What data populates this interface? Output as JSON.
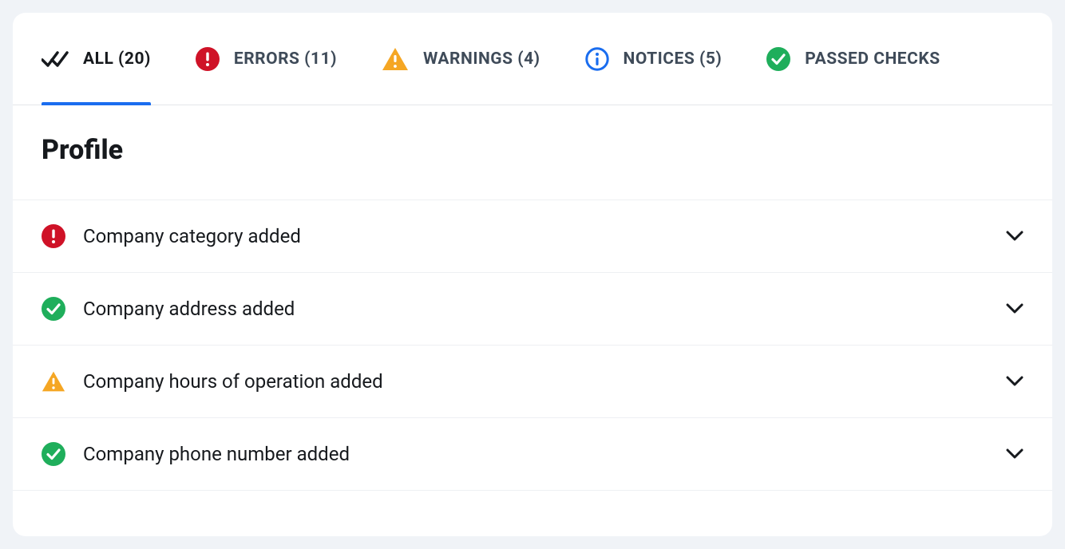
{
  "tabs": {
    "all": {
      "label": "ALL (20)"
    },
    "errors": {
      "label": "ERRORS (11)"
    },
    "warnings": {
      "label": "WARNINGS (4)"
    },
    "notices": {
      "label": "NOTICES (5)"
    },
    "passed": {
      "label": "PASSED CHECKS"
    }
  },
  "section": {
    "title": "Profile"
  },
  "items": [
    {
      "label": "Company category added",
      "status": "error"
    },
    {
      "label": "Company address added",
      "status": "passed"
    },
    {
      "label": "Company hours of operation added",
      "status": "warning"
    },
    {
      "label": "Company phone number added",
      "status": "passed"
    }
  ],
  "colors": {
    "error": "#cf1227",
    "warning": "#f5a623",
    "notice": "#1a6def",
    "passed": "#1fae5b"
  }
}
